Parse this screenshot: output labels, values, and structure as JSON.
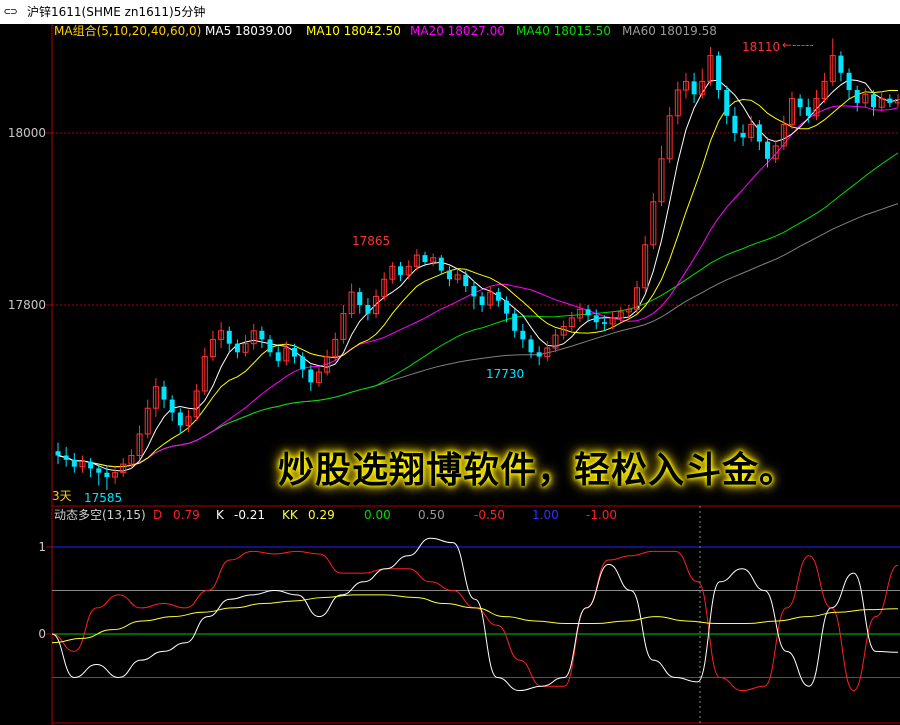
{
  "window": {
    "icon": "⊂⊃",
    "title": "沪锌1611(SHME zn1611)5分钟"
  },
  "ma_legend": {
    "group": "MA组合(5,10,20,40,60,0)",
    "ma5": "MA5 18039.00",
    "ma10": "MA10 18042.50",
    "ma20": "MA20 18027.00",
    "ma40": "MA40 18015.50",
    "ma60": "MA60 18019.58"
  },
  "indicator_legend": {
    "name": "动态多空(13,15)",
    "d_label": "D",
    "d_value": "0.79",
    "k_label": "K",
    "k_value": "-0.21",
    "kk_label": "KK",
    "kk_value": "0.29",
    "ref1": "0.00",
    "ref2": "0.50",
    "ref3": "-0.50",
    "ref4": "1.00",
    "ref5": "-1.00"
  },
  "annotations": {
    "high": "18110",
    "arrow": "←-----",
    "peak": "17865",
    "trough": "17730",
    "low_days": "3天",
    "low": "17585"
  },
  "promo": "炒股选翔博软件，轻松入斗金。",
  "colors": {
    "bg": "#000000",
    "up": "#ff3232",
    "down": "#00e4ff",
    "ma5": "#ffffff",
    "ma10": "#ffff00",
    "ma20": "#ff00ff",
    "ma40": "#00dd00",
    "ma60": "#808080",
    "d_line": "#ff2020",
    "k_line": "#ffffff",
    "kk_line": "#ffff33"
  },
  "chart_data": [
    {
      "type": "candlestick",
      "title": "沪锌1611(SHME zn1611)5分钟",
      "y_ticks": [
        18000,
        17800
      ],
      "ylim": [
        17560,
        18120
      ],
      "annotations": {
        "high": 18110,
        "peak": 17865,
        "trough": 17730,
        "low": 17585
      },
      "candles": [
        [
          17630,
          17625,
          17640,
          17615
        ],
        [
          17625,
          17620,
          17635,
          17612
        ],
        [
          17620,
          17612,
          17628,
          17605
        ],
        [
          17612,
          17618,
          17625,
          17605
        ],
        [
          17618,
          17610,
          17622,
          17600
        ],
        [
          17610,
          17605,
          17615,
          17590
        ],
        [
          17605,
          17600,
          17612,
          17585
        ],
        [
          17600,
          17605,
          17612,
          17592
        ],
        [
          17605,
          17615,
          17622,
          17600
        ],
        [
          17615,
          17625,
          17632,
          17610
        ],
        [
          17625,
          17650,
          17660,
          17620
        ],
        [
          17650,
          17680,
          17690,
          17645
        ],
        [
          17680,
          17705,
          17715,
          17670
        ],
        [
          17705,
          17690,
          17712,
          17680
        ],
        [
          17690,
          17675,
          17695,
          17665
        ],
        [
          17675,
          17660,
          17680,
          17650
        ],
        [
          17660,
          17670,
          17678,
          17652
        ],
        [
          17670,
          17700,
          17708,
          17665
        ],
        [
          17700,
          17740,
          17750,
          17695
        ],
        [
          17740,
          17760,
          17770,
          17735
        ],
        [
          17760,
          17770,
          17780,
          17750
        ],
        [
          17770,
          17755,
          17775,
          17745
        ],
        [
          17755,
          17745,
          17760,
          17738
        ],
        [
          17745,
          17755,
          17765,
          17740
        ],
        [
          17755,
          17770,
          17778,
          17748
        ],
        [
          17770,
          17760,
          17775,
          17750
        ],
        [
          17760,
          17745,
          17765,
          17740
        ],
        [
          17745,
          17735,
          17752,
          17728
        ],
        [
          17735,
          17750,
          17758,
          17730
        ],
        [
          17750,
          17740,
          17755,
          17732
        ],
        [
          17740,
          17725,
          17745,
          17715
        ],
        [
          17725,
          17710,
          17730,
          17700
        ],
        [
          17710,
          17722,
          17728,
          17705
        ],
        [
          17722,
          17740,
          17748,
          17718
        ],
        [
          17740,
          17760,
          17768,
          17735
        ],
        [
          17760,
          17790,
          17800,
          17755
        ],
        [
          17790,
          17815,
          17825,
          17785
        ],
        [
          17815,
          17800,
          17820,
          17790
        ],
        [
          17800,
          17790,
          17808,
          17782
        ],
        [
          17790,
          17810,
          17818,
          17785
        ],
        [
          17810,
          17830,
          17838,
          17805
        ],
        [
          17830,
          17845,
          17850,
          17825
        ],
        [
          17845,
          17835,
          17850,
          17828
        ],
        [
          17835,
          17845,
          17852,
          17830
        ],
        [
          17845,
          17858,
          17865,
          17840
        ],
        [
          17858,
          17850,
          17862,
          17845
        ],
        [
          17850,
          17855,
          17860,
          17845
        ],
        [
          17855,
          17840,
          17858,
          17835
        ],
        [
          17840,
          17830,
          17845,
          17822
        ],
        [
          17830,
          17835,
          17842,
          17825
        ],
        [
          17835,
          17822,
          17840,
          17815
        ],
        [
          17822,
          17810,
          17828,
          17795
        ],
        [
          17810,
          17800,
          17815,
          17792
        ],
        [
          17800,
          17815,
          17822,
          17795
        ],
        [
          17815,
          17805,
          17820,
          17798
        ],
        [
          17805,
          17790,
          17810,
          17780
        ],
        [
          17790,
          17770,
          17795,
          17762
        ],
        [
          17770,
          17760,
          17778,
          17750
        ],
        [
          17760,
          17745,
          17765,
          17738
        ],
        [
          17745,
          17740,
          17752,
          17730
        ],
        [
          17740,
          17750,
          17758,
          17735
        ],
        [
          17750,
          17765,
          17772,
          17745
        ],
        [
          17765,
          17775,
          17782,
          17760
        ],
        [
          17775,
          17785,
          17792,
          17770
        ],
        [
          17785,
          17795,
          17802,
          17780
        ],
        [
          17795,
          17788,
          17800,
          17780
        ],
        [
          17788,
          17780,
          17795,
          17772
        ],
        [
          17780,
          17778,
          17788,
          17770
        ],
        [
          17778,
          17785,
          17792,
          17772
        ],
        [
          17785,
          17792,
          17798,
          17780
        ],
        [
          17792,
          17795,
          17800,
          17785
        ],
        [
          17795,
          17820,
          17828,
          17790
        ],
        [
          17820,
          17870,
          17880,
          17815
        ],
        [
          17870,
          17920,
          17930,
          17865
        ],
        [
          17920,
          17970,
          17985,
          17915
        ],
        [
          17970,
          18020,
          18030,
          17965
        ],
        [
          18020,
          18050,
          18060,
          18010
        ],
        [
          18050,
          18060,
          18070,
          18040
        ],
        [
          18060,
          18045,
          18070,
          18035
        ],
        [
          18045,
          18060,
          18075,
          18040
        ],
        [
          18060,
          18090,
          18100,
          18055
        ],
        [
          18090,
          18050,
          18095,
          18040
        ],
        [
          18050,
          18020,
          18055,
          18010
        ],
        [
          18020,
          18000,
          18030,
          17990
        ],
        [
          18000,
          17995,
          18010,
          17985
        ],
        [
          17995,
          18010,
          18020,
          17990
        ],
        [
          18010,
          17990,
          18015,
          17980
        ],
        [
          17990,
          17970,
          17995,
          17960
        ],
        [
          17970,
          17985,
          17992,
          17965
        ],
        [
          17985,
          18010,
          18020,
          17980
        ],
        [
          18010,
          18040,
          18048,
          18005
        ],
        [
          18040,
          18030,
          18045,
          18020
        ],
        [
          18030,
          18020,
          18040,
          18012
        ],
        [
          18020,
          18040,
          18050,
          18015
        ],
        [
          18040,
          18060,
          18070,
          18035
        ],
        [
          18060,
          18090,
          18110,
          18055
        ],
        [
          18090,
          18070,
          18095,
          18060
        ],
        [
          18070,
          18050,
          18075,
          18040
        ],
        [
          18050,
          18035,
          18055,
          18025
        ],
        [
          18035,
          18045,
          18052,
          18030
        ],
        [
          18045,
          18030,
          18050,
          18020
        ],
        [
          18030,
          18040,
          18048,
          18025
        ],
        [
          18040,
          18035,
          18045,
          18030
        ],
        [
          18035,
          18039,
          18045,
          18030
        ]
      ]
    },
    {
      "type": "line",
      "title": "动态多空(13,15)",
      "y_ticks": [
        1,
        0
      ],
      "reference_lines": [
        1.0,
        0.5,
        0.0,
        -0.5
      ],
      "series": [
        {
          "name": "D",
          "values": [
            0,
            -0.2,
            0.3,
            0.45,
            0.3,
            0.35,
            0.3,
            0.5,
            0.85,
            0.95,
            0.92,
            0.95,
            0.92,
            0.7,
            0.7,
            0.75,
            0.75,
            0.6,
            0.5,
            0.3,
            0.1,
            -0.3,
            -0.6,
            -0.6,
            0.3,
            0.85,
            0.9,
            0.95,
            0.95,
            0.6,
            -0.5,
            -0.65,
            -0.6,
            0.3,
            0.9,
            0.3,
            -0.65,
            0.2,
            0.79
          ]
        },
        {
          "name": "K",
          "values": [
            0,
            -0.5,
            -0.35,
            -0.5,
            -0.3,
            -0.2,
            -0.1,
            0.2,
            0.4,
            0.45,
            0.5,
            0.45,
            0.2,
            0.45,
            0.6,
            0.75,
            0.9,
            1.1,
            1.05,
            0.4,
            -0.5,
            -0.65,
            -0.6,
            -0.5,
            0.3,
            0.8,
            0.5,
            -0.3,
            -0.5,
            -0.55,
            0.6,
            0.75,
            0.5,
            -0.2,
            -0.6,
            0.3,
            0.7,
            -0.2,
            -0.21
          ]
        },
        {
          "name": "KK",
          "values": [
            -0.1,
            -0.05,
            0.05,
            0.15,
            0.2,
            0.25,
            0.3,
            0.35,
            0.38,
            0.42,
            0.45,
            0.45,
            0.42,
            0.35,
            0.3,
            0.2,
            0.15,
            0.12,
            0.12,
            0.15,
            0.2,
            0.15,
            0.12,
            0.12,
            0.15,
            0.2,
            0.25,
            0.28,
            0.29
          ]
        }
      ]
    }
  ]
}
